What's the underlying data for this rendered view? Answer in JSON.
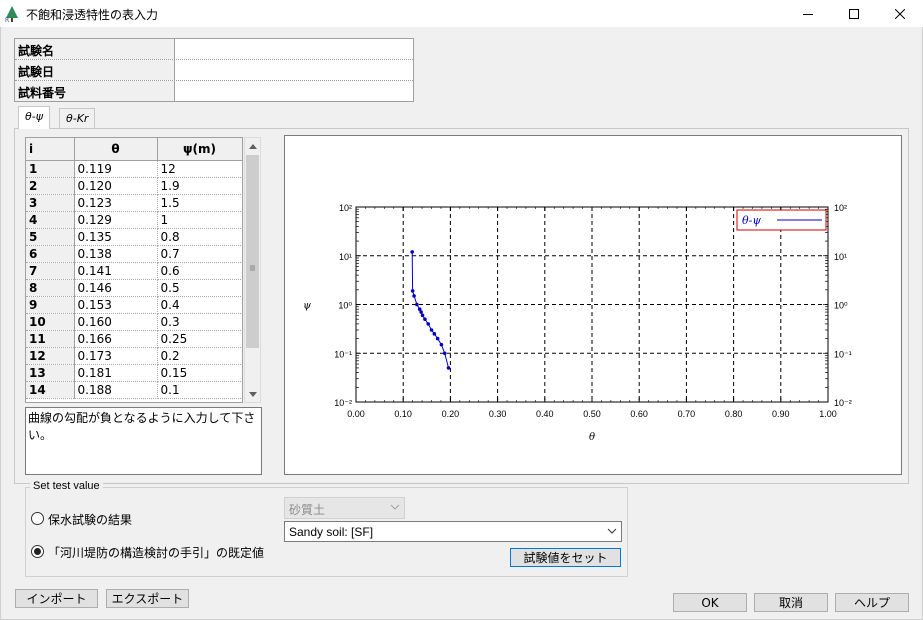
{
  "window": {
    "title": "不飽和浸透特性の表入力",
    "app_icon": "tree-icon",
    "controls": [
      "minimize-icon",
      "maximize-icon",
      "close-icon"
    ]
  },
  "info": [
    {
      "label": "試験名",
      "value": ""
    },
    {
      "label": "試験日",
      "value": ""
    },
    {
      "label": "試料番号",
      "value": ""
    }
  ],
  "tabs": [
    {
      "label": "θ-ψ",
      "active": true
    },
    {
      "label": "θ-Kr",
      "active": false
    }
  ],
  "table": {
    "columns": [
      "i",
      "θ",
      "ψ(m)"
    ],
    "rows": [
      [
        "1",
        "0.119",
        "12"
      ],
      [
        "2",
        "0.120",
        "1.9"
      ],
      [
        "3",
        "0.123",
        "1.5"
      ],
      [
        "4",
        "0.129",
        "1"
      ],
      [
        "5",
        "0.135",
        "0.8"
      ],
      [
        "6",
        "0.138",
        "0.7"
      ],
      [
        "7",
        "0.141",
        "0.6"
      ],
      [
        "8",
        "0.146",
        "0.5"
      ],
      [
        "9",
        "0.153",
        "0.4"
      ],
      [
        "10",
        "0.160",
        "0.3"
      ],
      [
        "11",
        "0.166",
        "0.25"
      ],
      [
        "12",
        "0.173",
        "0.2"
      ],
      [
        "13",
        "0.181",
        "0.15"
      ],
      [
        "14",
        "0.188",
        "0.1"
      ]
    ]
  },
  "memo": "曲線の勾配が負となるように入力して下さい。",
  "chart_data": {
    "type": "line",
    "title": "",
    "xlabel": "θ",
    "ylabel": "ψ",
    "xlim": [
      0,
      1
    ],
    "ylim": [
      0.01,
      100
    ],
    "y_scale": "log",
    "x_ticks": [
      "0.00",
      "0.10",
      "0.20",
      "0.30",
      "0.40",
      "0.50",
      "0.60",
      "0.70",
      "0.80",
      "0.90",
      "1.00"
    ],
    "y_ticks": [
      "10⁻²",
      "10⁻¹",
      "10⁰",
      "10¹",
      "10²"
    ],
    "grid": true,
    "legend_position": "top-right",
    "series": [
      {
        "name": "θ-ψ",
        "color": "#0000cc",
        "x": [
          0.119,
          0.12,
          0.123,
          0.129,
          0.135,
          0.138,
          0.141,
          0.146,
          0.153,
          0.16,
          0.166,
          0.173,
          0.181,
          0.188,
          0.196
        ],
        "y": [
          12,
          1.9,
          1.5,
          1.0,
          0.8,
          0.7,
          0.6,
          0.5,
          0.4,
          0.3,
          0.25,
          0.2,
          0.15,
          0.1,
          0.05
        ]
      }
    ]
  },
  "set_test": {
    "legend": "Set test value",
    "option1": "保水試験の結果",
    "option2": "「河川堤防の構造検討の手引」の既定値",
    "selected": "option2",
    "soil_type": "砂質土",
    "soil_preset": "Sandy soil: [SF]",
    "set_button": "試験値をセット"
  },
  "buttons": {
    "import": "インポート",
    "export": "エクスポート",
    "ok": "OK",
    "cancel": "取消",
    "help": "ヘルプ"
  }
}
